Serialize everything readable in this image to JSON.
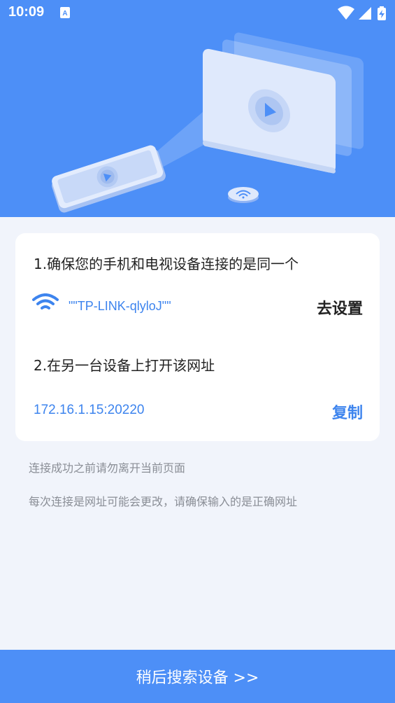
{
  "status_bar": {
    "time": "10:09",
    "icons": [
      "notification-a-icon",
      "wifi-icon",
      "signal-icon",
      "battery-charging-icon"
    ]
  },
  "hero": {
    "illustration": "phone-screen-casting-to-tv-illustration"
  },
  "card": {
    "step1": "1.确保您的手机和电视设备连接的是同一个",
    "wifi_name": "\"\"TP-LINK-qlyloJ\"\"",
    "settings_button": "去设置",
    "step2": "2.在另一台设备上打开该网址",
    "url": "172.16.1.15:20220",
    "copy_button": "复制"
  },
  "tips": {
    "tip1": "连接成功之前请勿离开当前页面",
    "tip2": "每次连接是网址可能会更改，请确保输入的是正确网址"
  },
  "bottom_button": "稍后搜索设备 >>",
  "colors": {
    "primary": "#4d8ff7",
    "link": "#3d84ee",
    "background": "#f1f4fb"
  }
}
